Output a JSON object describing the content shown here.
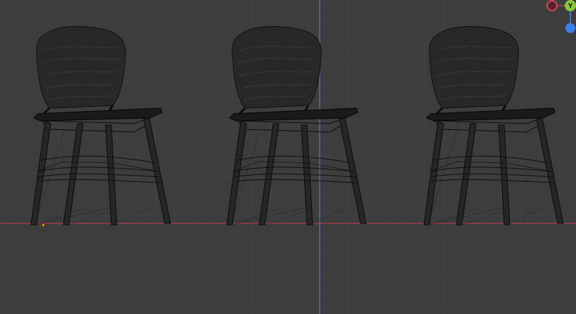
{
  "viewport": {
    "colors": {
      "background": "#3d3d3d",
      "grid_minor": "#474747",
      "grid_major": "#525252",
      "x_axis_line": "#9b3b48",
      "z_axis_line": "#4d73b8",
      "wire": "#0c0c0c",
      "wire_mesh": "#222222",
      "origin": "#ff9b1a"
    },
    "objects": [
      {
        "name": "chair-1"
      },
      {
        "name": "chair-2"
      },
      {
        "name": "chair-3"
      }
    ]
  },
  "gizmo": {
    "x_axis": {
      "label": "",
      "color": "#d9425b",
      "icon": "x-axis-handle"
    },
    "y_axis": {
      "label": "Y",
      "color": "#8cc83c",
      "icon": "y-axis-handle"
    },
    "z_axis": {
      "label": "",
      "color": "#3d7ee6",
      "icon": "z-axis-handle"
    }
  }
}
